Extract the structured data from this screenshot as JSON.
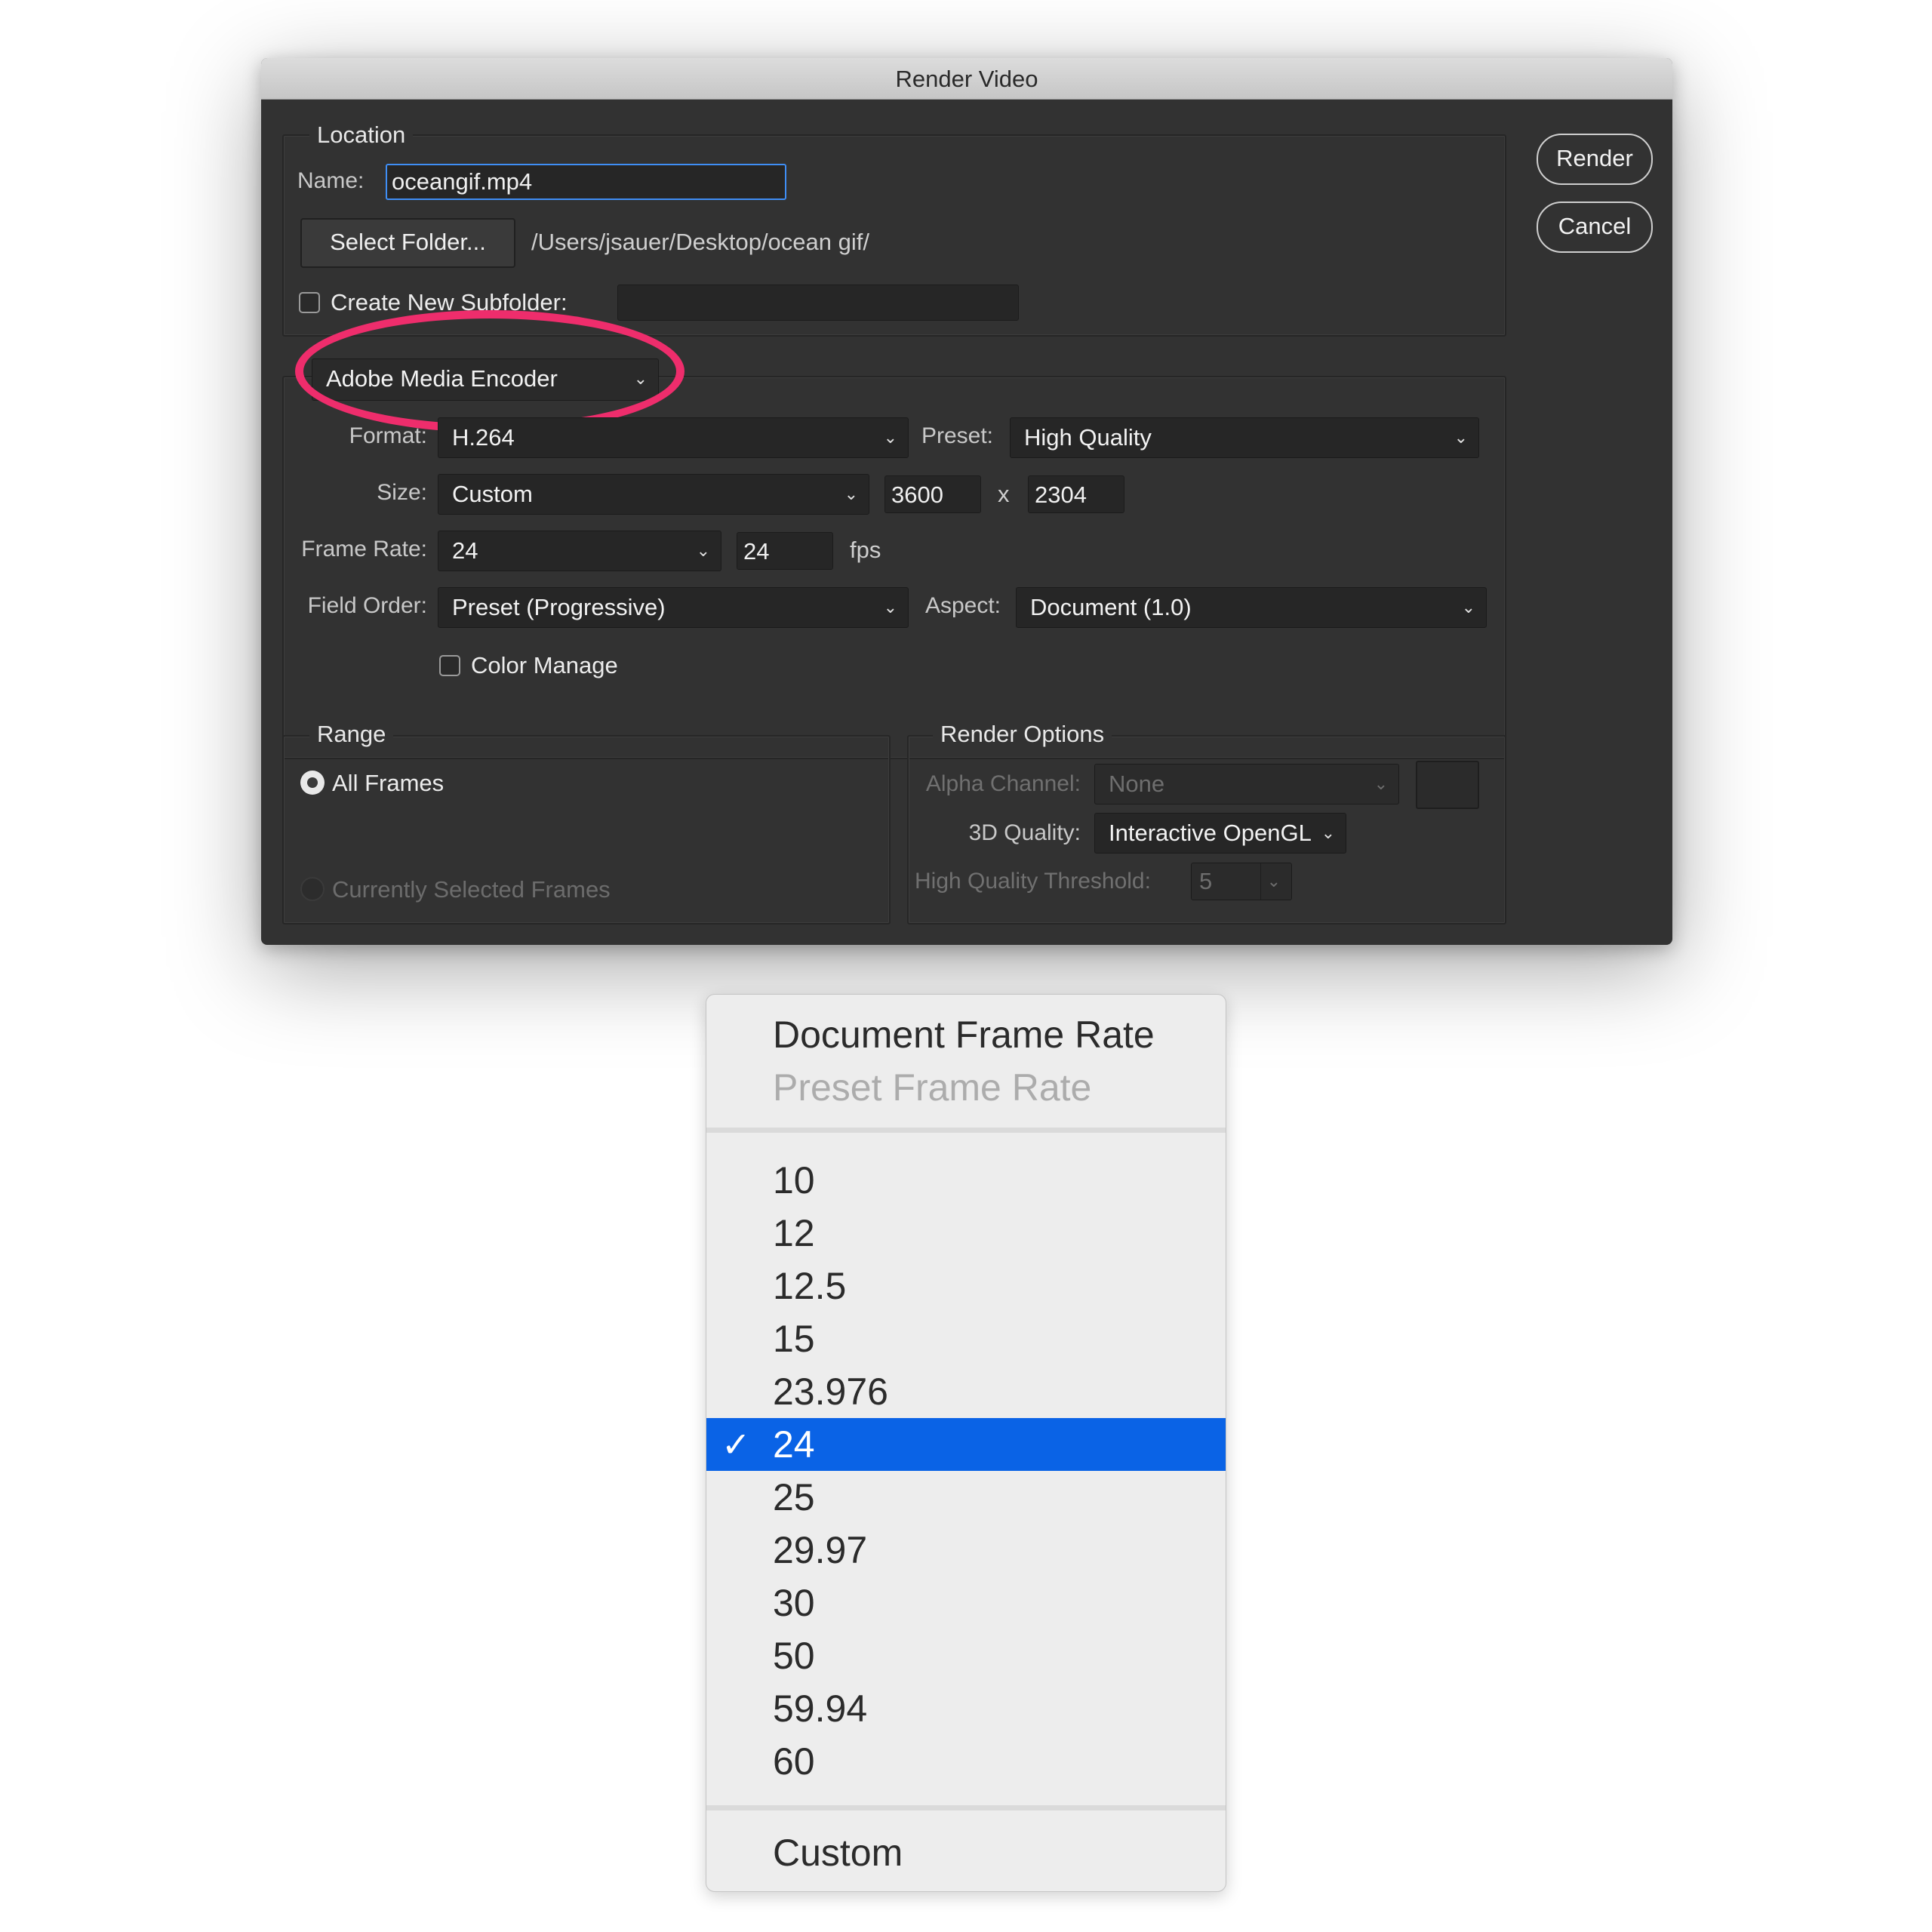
{
  "dialog": {
    "title": "Render Video",
    "render_label": "Render",
    "cancel_label": "Cancel"
  },
  "location": {
    "legend": "Location",
    "name_label": "Name:",
    "name_value": "oceangif.mp4",
    "select_folder_label": "Select Folder...",
    "folder_path": "/Users/jsauer/Desktop/ocean gif/",
    "subfolder_label": "Create New Subfolder:",
    "subfolder_value": "",
    "subfolder_checked": false
  },
  "encoder": {
    "selected": "Adobe Media Encoder",
    "highlight_color": "#ee2d6c",
    "format_label": "Format:",
    "format_value": "H.264",
    "preset_label": "Preset:",
    "preset_value": "High Quality",
    "size_label": "Size:",
    "size_value": "Custom",
    "width_value": "3600",
    "times_label": "x",
    "height_value": "2304",
    "frame_rate_label": "Frame Rate:",
    "frame_rate_value": "24",
    "fps_value": "24",
    "fps_label": "fps",
    "field_order_label": "Field Order:",
    "field_order_value": "Preset (Progressive)",
    "aspect_label": "Aspect:",
    "aspect_value": "Document (1.0)",
    "color_manage_label": "Color Manage",
    "color_manage_checked": false
  },
  "range": {
    "legend": "Range",
    "all_frames_label": "All Frames",
    "selected_frames_label": "Currently Selected Frames",
    "selected": "All Frames"
  },
  "render_options": {
    "legend": "Render Options",
    "alpha_label": "Alpha Channel:",
    "alpha_value": "None",
    "quality_label": "3D Quality:",
    "quality_value": "Interactive OpenGL",
    "threshold_label": "High Quality Threshold:",
    "threshold_value": "5"
  },
  "frame_rate_menu": {
    "header_items": [
      "Document Frame Rate",
      "Preset Frame Rate"
    ],
    "disabled_items": [
      "Preset Frame Rate"
    ],
    "items": [
      "10",
      "12",
      "12.5",
      "15",
      "23.976",
      "24",
      "25",
      "29.97",
      "30",
      "50",
      "59.94",
      "60"
    ],
    "selected": "24",
    "check_glyph": "✓",
    "footer_item": "Custom",
    "selection_color": "#0a63e6"
  }
}
